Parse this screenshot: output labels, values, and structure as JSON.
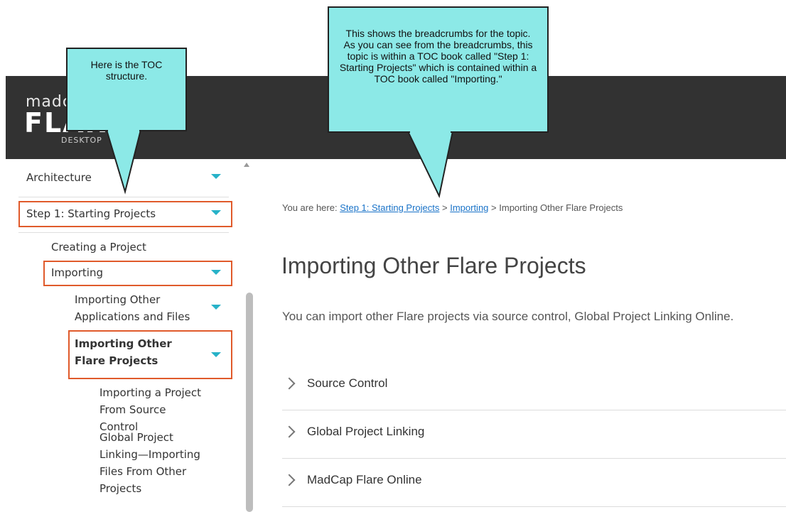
{
  "logo": {
    "small": "madcap",
    "big": "FLARE",
    "sub": "DESKTOP"
  },
  "sidebar": {
    "items": [
      {
        "label": "Architecture"
      },
      {
        "label": "Step 1: Starting Projects"
      },
      {
        "label": "Creating a Project"
      },
      {
        "label": "Importing"
      },
      {
        "label": "Importing Other Applications and Files"
      },
      {
        "label": "Importing Other Flare Projects"
      },
      {
        "label": "Importing a Project From Source Control"
      },
      {
        "label": "Global Project Linking—Importing Files From Other Projects"
      }
    ]
  },
  "breadcrumb": {
    "prefix": "You are here: ",
    "link1": "Step 1: Starting Projects",
    "sep1": " > ",
    "link2": "Importing",
    "sep2": " > ",
    "current": "Importing Other Flare Projects"
  },
  "main": {
    "title": "Importing Other Flare Projects",
    "intro": "You can import other Flare projects via source control, Global Project Linking Online.",
    "accordions": [
      {
        "label": "Source Control"
      },
      {
        "label": "Global Project Linking"
      },
      {
        "label": "MadCap Flare Online"
      }
    ]
  },
  "callouts": {
    "toc": "Here is the TOC structure.",
    "breadcrumbs": "This shows the breadcrumbs for the topic. As you can see from the breadcrumbs, this topic is within a TOC book called \"Step 1: Starting Projects\" which is contained within a TOC book called \"Importing.\""
  },
  "colors": {
    "accent": "#27b2c8",
    "highlight": "#e05a2b",
    "callout": "#8ce9e7",
    "header": "#323232",
    "link": "#1a73c8"
  }
}
